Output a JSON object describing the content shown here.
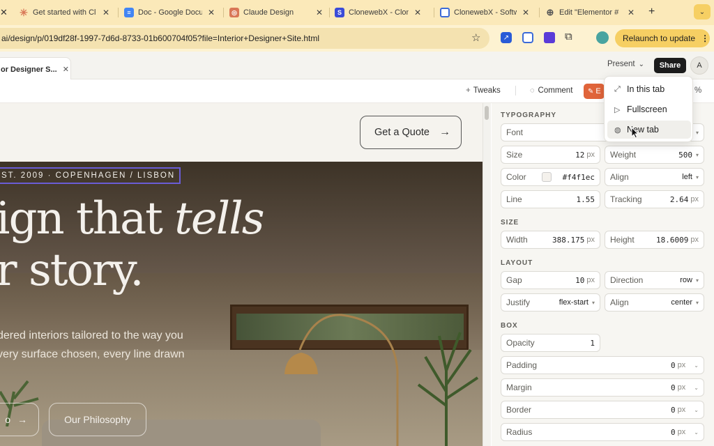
{
  "browser": {
    "tabs": [
      {
        "title": "Get started with Cl",
        "favicon": "sparkle-icon",
        "color": "#d97757"
      },
      {
        "title": "Doc - Google Docu",
        "favicon": "docs-icon",
        "color": "#4285f4"
      },
      {
        "title": "Claude Design",
        "favicon": "claude-icon",
        "color": "#d97757"
      },
      {
        "title": "ClonewebX - Clon",
        "favicon": "clonewebx-icon",
        "color": "#3b4cd8"
      },
      {
        "title": "ClonewebX - Softw",
        "favicon": "copy-icon",
        "color": "#3b6ad8"
      },
      {
        "title": "Edit \"Elementor #",
        "favicon": "globe-icon",
        "color": "#555555"
      }
    ],
    "url": "ai/design/p/019df28f-1997-7d6d-8733-01b600704f05?file=Interior+Designer+Site.html",
    "relaunch_label": "Relaunch to update"
  },
  "app": {
    "doc_tab_title": "or Designer S...",
    "present_label": "Present",
    "share_label": "Share",
    "avatar_letter": "A",
    "tweaks_label": "Tweaks",
    "comment_label": "Comment",
    "edit_label": "E",
    "zoom_fragment": "%"
  },
  "present_menu": {
    "items": [
      {
        "label": "In this tab",
        "icon": "expand-icon"
      },
      {
        "label": "Fullscreen",
        "icon": "play-icon"
      },
      {
        "label": "New tab",
        "icon": "globe-icon"
      }
    ]
  },
  "canvas": {
    "cta_label": "Get a Quote",
    "est_label": "ST. 2009 · COPENHAGEN / LISBON",
    "headline_line1": "ign that ",
    "headline_italic": "tells",
    "headline_line2": "r story.",
    "body_line1": "dered interiors tailored to the way you",
    "body_line2": "very surface chosen, every line drawn",
    "btn_primary_fragment": "o",
    "btn_secondary": "Our Philosophy"
  },
  "panel": {
    "typography_title": "TYPOGRAPHY",
    "font_label": "Font",
    "size_label": "Size",
    "size_value": "12",
    "size_unit": "px",
    "weight_label": "Weight",
    "weight_value": "500",
    "color_label": "Color",
    "color_value": "#f4f1ec",
    "align_label": "Align",
    "align_value": "left",
    "line_label": "Line",
    "line_value": "1.55",
    "tracking_label": "Tracking",
    "tracking_value": "2.64",
    "tracking_unit": "px",
    "size_title": "SIZE",
    "width_label": "Width",
    "width_value": "388.175",
    "width_unit": "px",
    "height_label": "Height",
    "height_value": "18.6009",
    "height_unit": "px",
    "layout_title": "LAYOUT",
    "gap_label": "Gap",
    "gap_value": "10",
    "gap_unit": "px",
    "direction_label": "Direction",
    "direction_value": "row",
    "justify_label": "Justify",
    "justify_value": "flex-start",
    "align2_label": "Align",
    "align2_value": "center",
    "box_title": "BOX",
    "opacity_label": "Opacity",
    "opacity_value": "1",
    "padding_label": "Padding",
    "padding_value": "0",
    "padding_unit": "px",
    "margin_label": "Margin",
    "margin_value": "0",
    "margin_unit": "px",
    "border_label": "Border",
    "border_value": "0",
    "border_unit": "px",
    "radius_label": "Radius",
    "radius_value": "0",
    "radius_unit": "px"
  }
}
